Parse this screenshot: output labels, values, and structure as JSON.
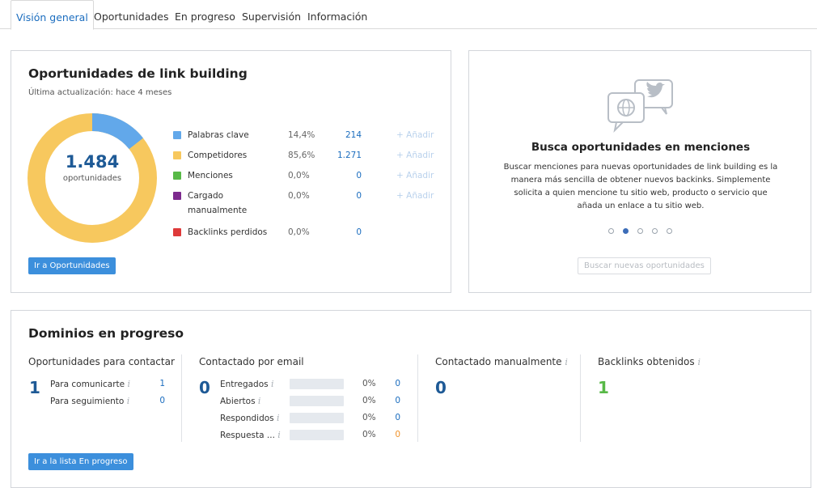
{
  "tabs": [
    {
      "label": "Visión general",
      "active": true
    },
    {
      "label": "Oportunidades"
    },
    {
      "label": "En progreso"
    },
    {
      "label": "Supervisión"
    },
    {
      "label": "Información"
    }
  ],
  "opportunities": {
    "title": "Oportunidades de link building",
    "updated": "Última actualización: hace 4 meses",
    "total": "1.484",
    "total_label": "oportunidades",
    "button": "Ir a Oportunidades",
    "add_label": "+ Añadir",
    "legend": [
      {
        "label": "Palabras clave",
        "pct": "14,4%",
        "value": "214",
        "color": "#62a8ea",
        "add": true
      },
      {
        "label": "Competidores",
        "pct": "85,6%",
        "value": "1.271",
        "color": "#f7c85e",
        "add": true
      },
      {
        "label": "Menciones",
        "pct": "0,0%",
        "value": "0",
        "color": "#58b947",
        "add": true
      },
      {
        "label": "Cargado",
        "label2": "manualmente",
        "pct": "0,0%",
        "value": "0",
        "color": "#7d2a8e",
        "add": true
      },
      {
        "label": "Backlinks perdidos",
        "pct": "0,0%",
        "value": "0",
        "color": "#de3a3a",
        "add": false
      }
    ]
  },
  "mentions": {
    "title": "Busca oportunidades en menciones",
    "body_lines": [
      "Buscar menciones para nuevas oportunidades de link building es la",
      "manera más sencilla de obtener nuevos backinks. Simplemente",
      "solicita a quien mencione tu sitio web, producto o servicio que",
      "añada un enlace a tu sitio web."
    ],
    "active_dot": 1,
    "dot_count": 5,
    "button": "Buscar nuevas oportunidades"
  },
  "progress": {
    "title": "Dominios en progreso",
    "button": "Ir a la lista En progreso",
    "contact": {
      "title": "Oportunidades para contactar",
      "total": "1",
      "rows": [
        {
          "label": "Para comunicarte",
          "value": "1"
        },
        {
          "label": "Para seguimiento",
          "value": "0"
        }
      ]
    },
    "email": {
      "title": "Contactado por email",
      "total": "0",
      "rows": [
        {
          "label": "Entregados",
          "pct": "0%",
          "value": "0",
          "value_color": "#1b6dbf"
        },
        {
          "label": "Abiertos",
          "pct": "0%",
          "value": "0",
          "value_color": "#1b6dbf"
        },
        {
          "label": "Respondidos",
          "pct": "0%",
          "value": "0",
          "value_color": "#1b6dbf"
        },
        {
          "label": "Respuesta ...",
          "pct": "0%",
          "value": "0",
          "value_color": "#f0932b"
        }
      ]
    },
    "manual": {
      "title": "Contactado manualmente",
      "total": "0"
    },
    "backlinks": {
      "title": "Backlinks obtenidos",
      "total": "1"
    }
  },
  "colors": {
    "accent": "#3c8fdc",
    "link": "#1b6dbf",
    "green": "#58b947"
  }
}
